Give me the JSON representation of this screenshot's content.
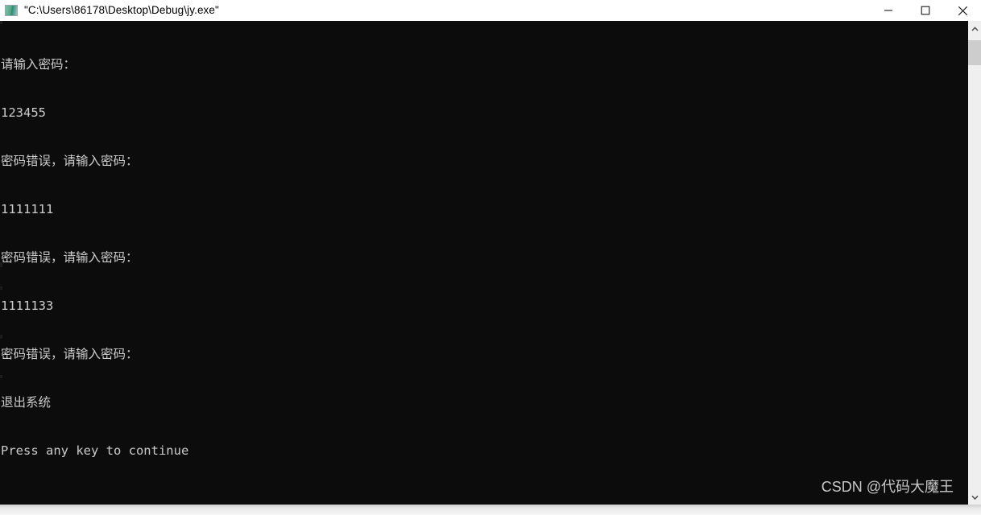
{
  "window": {
    "title": "\"C:\\Users\\86178\\Desktop\\Debug\\jy.exe\"",
    "icon_name": "console-app-icon",
    "controls": {
      "minimize_label": "Minimize",
      "maximize_label": "Maximize",
      "close_label": "Close"
    },
    "colors": {
      "titlebar_bg": "#ffffff",
      "console_bg": "#0c0c0c",
      "console_fg": "#cccccc",
      "scrollbar_track": "#efefef",
      "scrollbar_thumb": "#cdcdcd"
    }
  },
  "console": {
    "lines": [
      "请输入密码：",
      "123455",
      "密码错误，请输入密码：",
      "1111111",
      "密码错误，请输入密码：",
      "1111133",
      "密码错误，请输入密码：",
      "退出系统",
      "Press any key to continue"
    ]
  },
  "scrollbar": {
    "up_arrow": "▲",
    "down_arrow": "▼"
  },
  "watermark": {
    "text": "CSDN @代码大魔王"
  }
}
